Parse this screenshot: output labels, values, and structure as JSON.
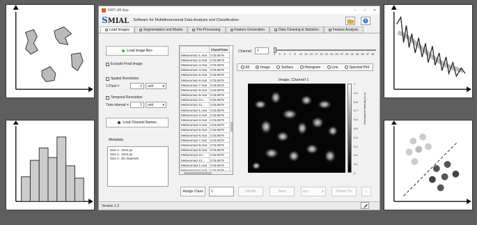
{
  "window": {
    "title": "MATLAB App",
    "controls": [
      "–",
      "□",
      "✕"
    ]
  },
  "header": {
    "logo_initial": "S",
    "logo_rest": "MIAL",
    "subtitle": "Software for Multidimensional Data Analysis and Classification"
  },
  "tabs": [
    {
      "label": "Load Images",
      "active": true
    },
    {
      "label": "Segmentation and Masks",
      "active": false
    },
    {
      "label": "Pre-Processing",
      "active": false
    },
    {
      "label": "Feature Generation",
      "active": false
    },
    {
      "label": "Data Cleaning & Statistics",
      "active": false
    },
    {
      "label": "Feature Analysis",
      "active": false
    }
  ],
  "left": {
    "load_button": "Load image files",
    "exclude_final": "Exclude Final Image",
    "spatial_resolution": "Spatial Resolution",
    "pixel_label": "1 Pixel =",
    "pixel_value": "1",
    "pixel_unit": "unit",
    "temporal_resolution": "Temporal Resolution",
    "interval_label": "Time interval =",
    "interval_value": "1",
    "interval_unit": "unit",
    "load_channel_names": "Load Channel Names",
    "metadata_label": "Metadata",
    "metadata": [
      {
        "k": "Size x:",
        "v": "1024 px"
      },
      {
        "k": "Size y:",
        "v": "1024 px"
      },
      {
        "k": "Size z:",
        "v": "26 channels"
      }
    ]
  },
  "file_table": {
    "headers": [
      "",
      "Class/Time"
    ],
    "rows": [
      [
        "Melanoma1-1.mat",
        "COL0679"
      ],
      [
        "Melanoma1-2.mat",
        "COL0679"
      ],
      [
        "Melanoma1-3.mat",
        "COL0679"
      ],
      [
        "Melanoma1-4.mat",
        "COL0679"
      ],
      [
        "Melanoma1-5.mat",
        "COL0679"
      ],
      [
        "Melanoma1-6.mat",
        "COL0679"
      ],
      [
        "Melanoma1-7.mat",
        "COL0679"
      ],
      [
        "Melanoma1-8.mat",
        "COL0679"
      ],
      [
        "Melanoma1-9.mat",
        "COL0679"
      ],
      [
        "Melanoma1-10...",
        "COL0679"
      ],
      [
        "Melanoma1-11...",
        "COL0679"
      ],
      [
        "Melanoma2-1.mat",
        "COL0679"
      ],
      [
        "Melanoma2-2.mat",
        "COL0679"
      ],
      [
        "Melanoma2-3.mat",
        "COL0679"
      ],
      [
        "Melanoma2-4.mat",
        "COL0679"
      ],
      [
        "Melanoma2-5.mat",
        "COL0679"
      ],
      [
        "Melanoma2-6.mat",
        "COL0679"
      ],
      [
        "Melanoma2-7.mat",
        "COL0679"
      ],
      [
        "Melanoma2-8.mat",
        "COL0679"
      ],
      [
        "Melanoma2-9.mat",
        "COL0679"
      ],
      [
        "Melanoma2-10...",
        "COL0679"
      ],
      [
        "Melanoma2-11...",
        "COL0679"
      ],
      [
        "Melanoma3-1.mat",
        "COL0679"
      ],
      [
        "Melanoma3-2.mat",
        "COL0679"
      ]
    ]
  },
  "channel": {
    "label": "Channel:",
    "value": "1",
    "ticks": [
      "1",
      "3",
      "5",
      "7",
      "9",
      "11",
      "13",
      "15",
      "17",
      "19",
      "21",
      "23",
      "25",
      "27",
      "29",
      "31",
      "33",
      "35",
      "37",
      "39"
    ]
  },
  "view_modes": [
    {
      "label": "All",
      "selected": false
    },
    {
      "label": "Image",
      "selected": true
    },
    {
      "label": "Surface",
      "selected": false
    },
    {
      "label": "Histogram",
      "selected": false
    },
    {
      "label": "Line",
      "selected": false
    },
    {
      "label": "Spectral Plot",
      "selected": false
    }
  ],
  "image": {
    "title": "Image, Channel 1",
    "colorbar_ticks": [
      "1",
      "0.9",
      "0.8",
      "0.7",
      "0.6",
      "0.5",
      "0.4",
      "0.3",
      "0.2",
      "0.1",
      "0"
    ],
    "colorbar_label": "Normalized Intensity [a.u.]"
  },
  "bottom": {
    "assign_class": "Assign Class",
    "class_value": "1",
    "shuffle": "Shuffle",
    "save": "Save",
    "format": "any",
    "delete": "Delete Ch",
    "extra": "○"
  },
  "status": {
    "version": "Version 1.2"
  }
}
